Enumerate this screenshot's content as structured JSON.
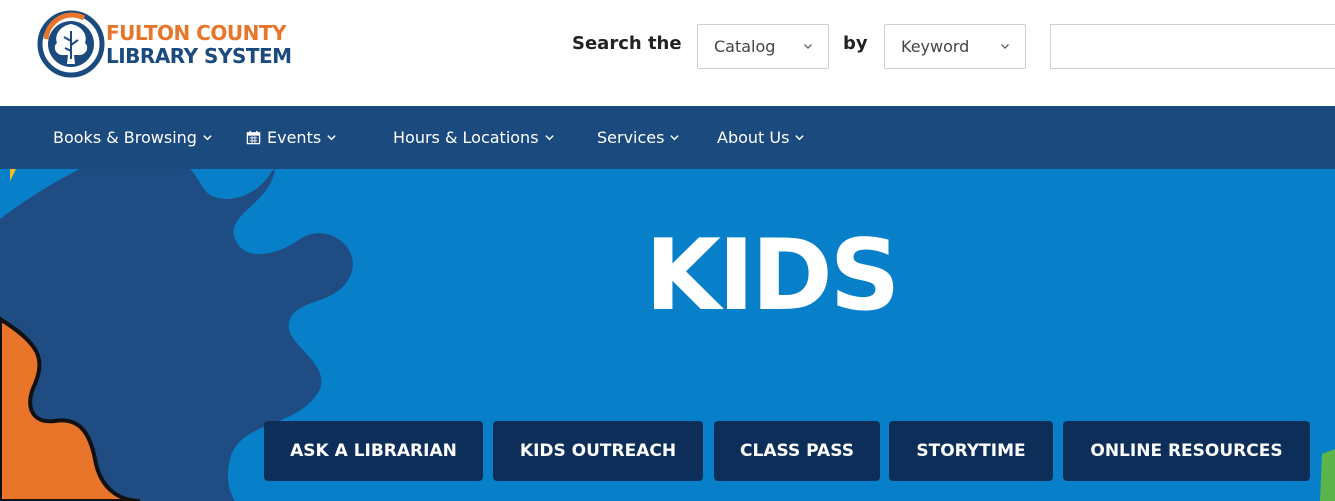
{
  "colors": {
    "brand_orange": "#e8752a",
    "brand_navy": "#1b4a7e",
    "hero_blue": "#0880c9",
    "button_navy": "#0e2e5a"
  },
  "header": {
    "logo": {
      "line1": "FULTON COUNTY",
      "line2": "LIBRARY SYSTEM",
      "icon": "tree-emblem-icon"
    },
    "search": {
      "label": "Search the",
      "scope_selected": "Catalog",
      "by_label": "by",
      "field_selected": "Keyword",
      "query_value": "",
      "chevron_icon": "chevron-down-icon"
    }
  },
  "nav": {
    "items": [
      {
        "label": "Books & Browsing",
        "icon": "chevron-down-icon"
      },
      {
        "label": "Events",
        "icon": "calendar-icon"
      },
      {
        "label": "Hours & Locations",
        "icon": "chevron-down-icon"
      },
      {
        "label": "Services",
        "icon": "chevron-down-icon"
      },
      {
        "label": "About Us",
        "icon": "chevron-down-icon"
      }
    ]
  },
  "hero": {
    "title": "KIDS",
    "background_art": "puzzle-pieces",
    "buttons": [
      {
        "label": "ASK A LIBRARIAN"
      },
      {
        "label": "KIDS OUTREACH"
      },
      {
        "label": "CLASS PASS"
      },
      {
        "label": "STORYTIME"
      },
      {
        "label": "ONLINE RESOURCES"
      }
    ]
  }
}
